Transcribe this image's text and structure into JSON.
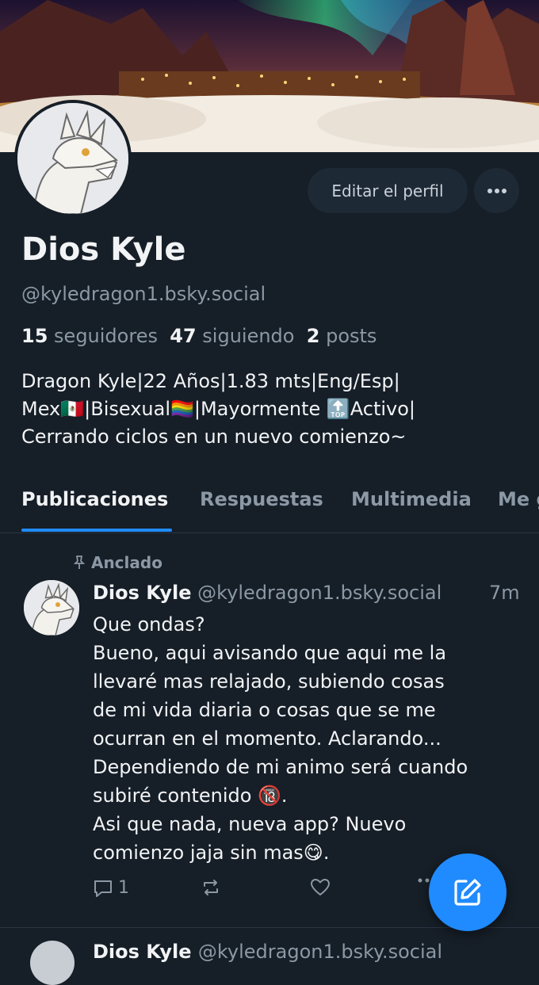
{
  "profile": {
    "display_name": "Dios Kyle",
    "handle": "@kyledragon1.bsky.social",
    "followers_count": "15",
    "followers_label": "seguidores",
    "following_count": "47",
    "following_label": "siguiendo",
    "posts_count": "2",
    "posts_label": "posts",
    "bio": "Dragon Kyle|22 Años|1.83 mts|Eng/Esp|\nMex🇲🇽|Bisexual🏳️‍🌈|Mayormente 🔝Activo|\nCerrando ciclos en un nuevo comienzo~"
  },
  "header": {
    "edit_label": "Editar el perfil"
  },
  "tabs": [
    {
      "label": "Publicaciones"
    },
    {
      "label": "Respuestas"
    },
    {
      "label": "Multimedia"
    },
    {
      "label": "Me g"
    }
  ],
  "post": {
    "pinned_label": "Anclado",
    "author": "Dios Kyle",
    "handle": "@kyledragon1.bsky.social",
    "time": "7m",
    "text": "Que ondas?\nBueno, aqui avisando que aqui me la\nllevaré mas relajado, subiendo cosas\nde mi vida diaria o cosas que se me\nocurran en el momento. Aclarando...\nDependiendo de mi animo será cuando\nsubiré contenido 🔞.\nAsi que nada, nueva app? Nuevo\ncomienzo jaja sin mas😋.",
    "reply_count": "1"
  },
  "next_post": {
    "author_partial": "Dios Kyle",
    "handle_partial": "@kyledragon1.bsky.social"
  },
  "colors": {
    "background": "#161e27",
    "accent": "#208bfe",
    "muted_text": "#8b98a5"
  },
  "icons": [
    "more-icon",
    "pin-icon",
    "reply-icon",
    "repost-icon",
    "like-icon",
    "compose-icon"
  ]
}
